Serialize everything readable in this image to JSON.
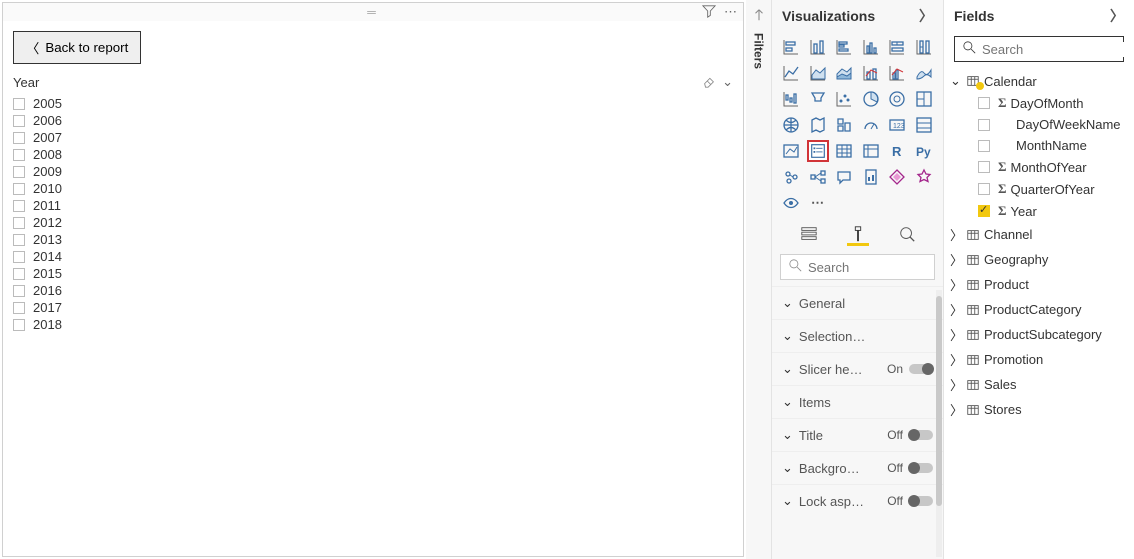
{
  "canvas": {
    "back_label": "Back to report",
    "slicer_title": "Year",
    "years": [
      "2005",
      "2006",
      "2007",
      "2008",
      "2009",
      "2010",
      "2011",
      "2012",
      "2013",
      "2014",
      "2015",
      "2016",
      "2017",
      "2018"
    ]
  },
  "filters_rail": {
    "label": "Filters"
  },
  "viz": {
    "title": "Visualizations",
    "search_placeholder": "Search",
    "icons": [
      "stacked-bar",
      "stacked-column",
      "clustered-bar",
      "clustered-column",
      "stacked-bar-100",
      "stacked-column-100",
      "line",
      "area",
      "stacked-area",
      "line-stacked-column",
      "line-clustered-column",
      "ribbon",
      "waterfall",
      "funnel",
      "scatter",
      "pie",
      "donut",
      "treemap",
      "map",
      "filled-map",
      "shape-map",
      "gauge",
      "card",
      "multi-row-card",
      "kpi",
      "slicer",
      "table",
      "matrix",
      "r-visual",
      "python-visual",
      "key-influencers",
      "decomposition-tree",
      "qna",
      "paginated",
      "powerapps",
      "custom-visual",
      "arcgis"
    ],
    "selected_icon": "slicer",
    "format_items": [
      {
        "label": "General",
        "toggle": null
      },
      {
        "label": "Selection controls",
        "toggle": null
      },
      {
        "label": "Slicer header",
        "label_trunc": "Slicer he…",
        "toggle": "On"
      },
      {
        "label": "Items",
        "toggle": null
      },
      {
        "label": "Title",
        "toggle": "Off"
      },
      {
        "label": "Background",
        "label_trunc": "Backgro…",
        "toggle": "Off"
      },
      {
        "label": "Lock aspect",
        "label_trunc": "Lock asp…",
        "toggle": "Off"
      }
    ]
  },
  "fields": {
    "title": "Fields",
    "search_placeholder": "Search",
    "tables": [
      {
        "name": "Calendar",
        "open": true,
        "pill": true,
        "columns": [
          {
            "name": "DayOfMonth",
            "sigma": true,
            "checked": false
          },
          {
            "name": "DayOfWeekName",
            "sigma": false,
            "checked": false
          },
          {
            "name": "MonthName",
            "sigma": false,
            "checked": false
          },
          {
            "name": "MonthOfYear",
            "sigma": true,
            "checked": false
          },
          {
            "name": "QuarterOfYear",
            "sigma": true,
            "checked": false
          },
          {
            "name": "Year",
            "sigma": true,
            "checked": true
          }
        ]
      },
      {
        "name": "Channel",
        "open": false
      },
      {
        "name": "Geography",
        "open": false
      },
      {
        "name": "Product",
        "open": false
      },
      {
        "name": "ProductCategory",
        "open": false
      },
      {
        "name": "ProductSubcategory",
        "open": false
      },
      {
        "name": "Promotion",
        "open": false
      },
      {
        "name": "Sales",
        "open": false
      },
      {
        "name": "Stores",
        "open": false
      }
    ]
  }
}
